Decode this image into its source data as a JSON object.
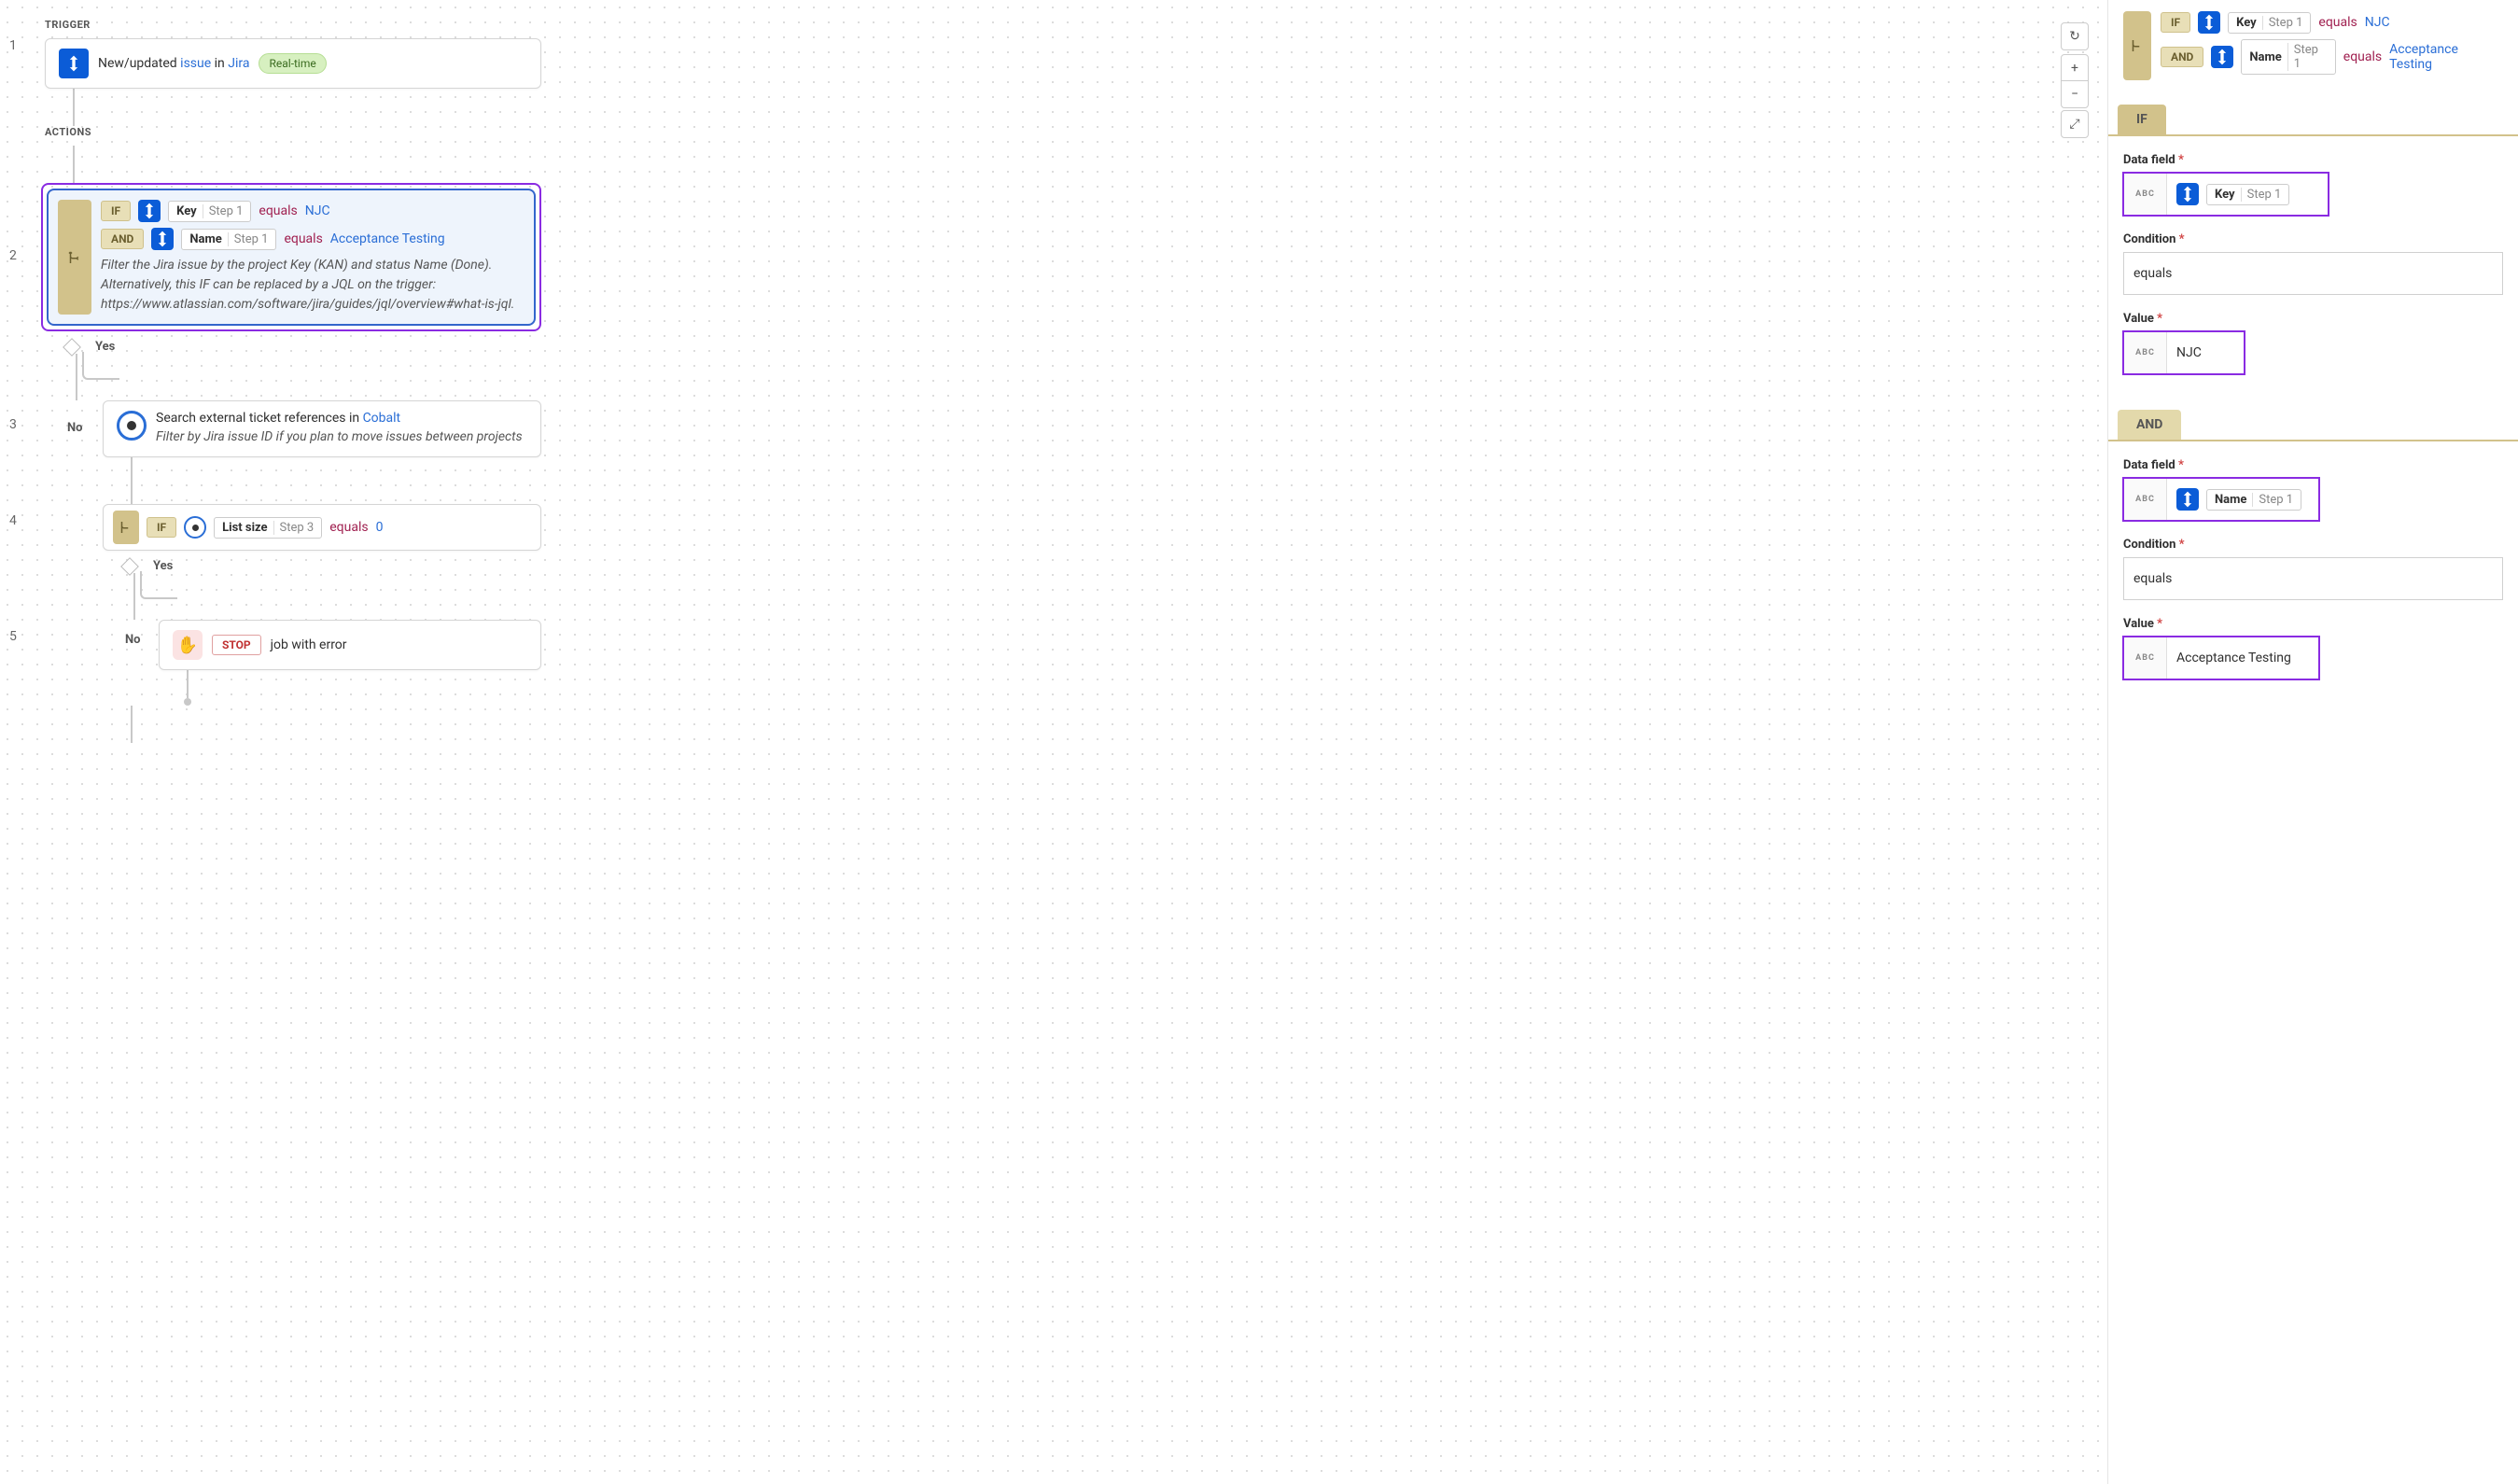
{
  "canvas": {
    "trigger_label": "TRIGGER",
    "actions_label": "ACTIONS",
    "steps": [
      "1",
      "2",
      "3",
      "4",
      "5"
    ],
    "trigger": {
      "prefix": "New/updated ",
      "link1": "issue",
      "mid": " in ",
      "link2": "Jira",
      "badge": "Real-time"
    },
    "cond": {
      "if_label": "IF",
      "and_label": "AND",
      "key_field": "Key",
      "key_step": "Step 1",
      "equals": "equals",
      "key_val": "NJC",
      "name_field": "Name",
      "name_step": "Step 1",
      "name_val": "Acceptance Testing",
      "desc": "Filter the Jira issue by the project Key (KAN) and status Name (Done). Alternatively, this IF can be replaced by a JQL on the trigger: https://www.atlassian.com/software/jira/guides/jql/overview#what-is-jql."
    },
    "yes": "Yes",
    "no": "No",
    "cobalt": {
      "title_pre": "Search external ticket references in ",
      "title_link": "Cobalt",
      "sub": "Filter by Jira issue ID if you plan to move issues between projects"
    },
    "cond2": {
      "if_label": "IF",
      "field": "List size",
      "step": "Step 3",
      "equals": "equals",
      "val": "0"
    },
    "stop": {
      "pill": "STOP",
      "text": "job with error"
    },
    "controls": {
      "undo": "↻",
      "plus": "+",
      "minus": "−",
      "fit": "⤢"
    }
  },
  "sidebar": {
    "summary": {
      "if_label": "IF",
      "and_label": "AND",
      "key_field": "Key",
      "key_step": "Step 1",
      "equals1": "equals",
      "val1": "NJC",
      "name_field": "Name",
      "name_step": "Step 1",
      "equals2": "equals",
      "val2": "Acceptance Testing"
    },
    "if_tab": "IF",
    "and_tab": "AND",
    "data_field_label": "Data field",
    "condition_label": "Condition",
    "value_label": "Value",
    "abc": "ABC",
    "if_block": {
      "field": "Key",
      "step": "Step 1",
      "condition": "equals",
      "value": "NJC"
    },
    "and_block": {
      "field": "Name",
      "step": "Step 1",
      "condition": "equals",
      "value": "Acceptance Testing"
    }
  }
}
